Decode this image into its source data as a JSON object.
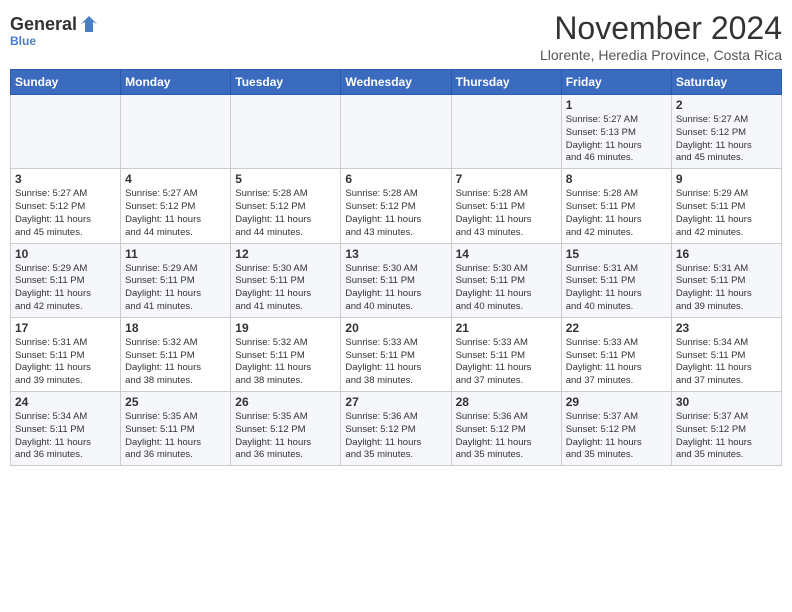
{
  "header": {
    "logo_general": "General",
    "logo_blue": "Blue",
    "month_title": "November 2024",
    "location": "Llorente, Heredia Province, Costa Rica"
  },
  "weekdays": [
    "Sunday",
    "Monday",
    "Tuesday",
    "Wednesday",
    "Thursday",
    "Friday",
    "Saturday"
  ],
  "weeks": [
    [
      {
        "day": "",
        "info": ""
      },
      {
        "day": "",
        "info": ""
      },
      {
        "day": "",
        "info": ""
      },
      {
        "day": "",
        "info": ""
      },
      {
        "day": "",
        "info": ""
      },
      {
        "day": "1",
        "info": "Sunrise: 5:27 AM\nSunset: 5:13 PM\nDaylight: 11 hours\nand 46 minutes."
      },
      {
        "day": "2",
        "info": "Sunrise: 5:27 AM\nSunset: 5:12 PM\nDaylight: 11 hours\nand 45 minutes."
      }
    ],
    [
      {
        "day": "3",
        "info": "Sunrise: 5:27 AM\nSunset: 5:12 PM\nDaylight: 11 hours\nand 45 minutes."
      },
      {
        "day": "4",
        "info": "Sunrise: 5:27 AM\nSunset: 5:12 PM\nDaylight: 11 hours\nand 44 minutes."
      },
      {
        "day": "5",
        "info": "Sunrise: 5:28 AM\nSunset: 5:12 PM\nDaylight: 11 hours\nand 44 minutes."
      },
      {
        "day": "6",
        "info": "Sunrise: 5:28 AM\nSunset: 5:12 PM\nDaylight: 11 hours\nand 43 minutes."
      },
      {
        "day": "7",
        "info": "Sunrise: 5:28 AM\nSunset: 5:11 PM\nDaylight: 11 hours\nand 43 minutes."
      },
      {
        "day": "8",
        "info": "Sunrise: 5:28 AM\nSunset: 5:11 PM\nDaylight: 11 hours\nand 42 minutes."
      },
      {
        "day": "9",
        "info": "Sunrise: 5:29 AM\nSunset: 5:11 PM\nDaylight: 11 hours\nand 42 minutes."
      }
    ],
    [
      {
        "day": "10",
        "info": "Sunrise: 5:29 AM\nSunset: 5:11 PM\nDaylight: 11 hours\nand 42 minutes."
      },
      {
        "day": "11",
        "info": "Sunrise: 5:29 AM\nSunset: 5:11 PM\nDaylight: 11 hours\nand 41 minutes."
      },
      {
        "day": "12",
        "info": "Sunrise: 5:30 AM\nSunset: 5:11 PM\nDaylight: 11 hours\nand 41 minutes."
      },
      {
        "day": "13",
        "info": "Sunrise: 5:30 AM\nSunset: 5:11 PM\nDaylight: 11 hours\nand 40 minutes."
      },
      {
        "day": "14",
        "info": "Sunrise: 5:30 AM\nSunset: 5:11 PM\nDaylight: 11 hours\nand 40 minutes."
      },
      {
        "day": "15",
        "info": "Sunrise: 5:31 AM\nSunset: 5:11 PM\nDaylight: 11 hours\nand 40 minutes."
      },
      {
        "day": "16",
        "info": "Sunrise: 5:31 AM\nSunset: 5:11 PM\nDaylight: 11 hours\nand 39 minutes."
      }
    ],
    [
      {
        "day": "17",
        "info": "Sunrise: 5:31 AM\nSunset: 5:11 PM\nDaylight: 11 hours\nand 39 minutes."
      },
      {
        "day": "18",
        "info": "Sunrise: 5:32 AM\nSunset: 5:11 PM\nDaylight: 11 hours\nand 38 minutes."
      },
      {
        "day": "19",
        "info": "Sunrise: 5:32 AM\nSunset: 5:11 PM\nDaylight: 11 hours\nand 38 minutes."
      },
      {
        "day": "20",
        "info": "Sunrise: 5:33 AM\nSunset: 5:11 PM\nDaylight: 11 hours\nand 38 minutes."
      },
      {
        "day": "21",
        "info": "Sunrise: 5:33 AM\nSunset: 5:11 PM\nDaylight: 11 hours\nand 37 minutes."
      },
      {
        "day": "22",
        "info": "Sunrise: 5:33 AM\nSunset: 5:11 PM\nDaylight: 11 hours\nand 37 minutes."
      },
      {
        "day": "23",
        "info": "Sunrise: 5:34 AM\nSunset: 5:11 PM\nDaylight: 11 hours\nand 37 minutes."
      }
    ],
    [
      {
        "day": "24",
        "info": "Sunrise: 5:34 AM\nSunset: 5:11 PM\nDaylight: 11 hours\nand 36 minutes."
      },
      {
        "day": "25",
        "info": "Sunrise: 5:35 AM\nSunset: 5:11 PM\nDaylight: 11 hours\nand 36 minutes."
      },
      {
        "day": "26",
        "info": "Sunrise: 5:35 AM\nSunset: 5:12 PM\nDaylight: 11 hours\nand 36 minutes."
      },
      {
        "day": "27",
        "info": "Sunrise: 5:36 AM\nSunset: 5:12 PM\nDaylight: 11 hours\nand 35 minutes."
      },
      {
        "day": "28",
        "info": "Sunrise: 5:36 AM\nSunset: 5:12 PM\nDaylight: 11 hours\nand 35 minutes."
      },
      {
        "day": "29",
        "info": "Sunrise: 5:37 AM\nSunset: 5:12 PM\nDaylight: 11 hours\nand 35 minutes."
      },
      {
        "day": "30",
        "info": "Sunrise: 5:37 AM\nSunset: 5:12 PM\nDaylight: 11 hours\nand 35 minutes."
      }
    ]
  ]
}
